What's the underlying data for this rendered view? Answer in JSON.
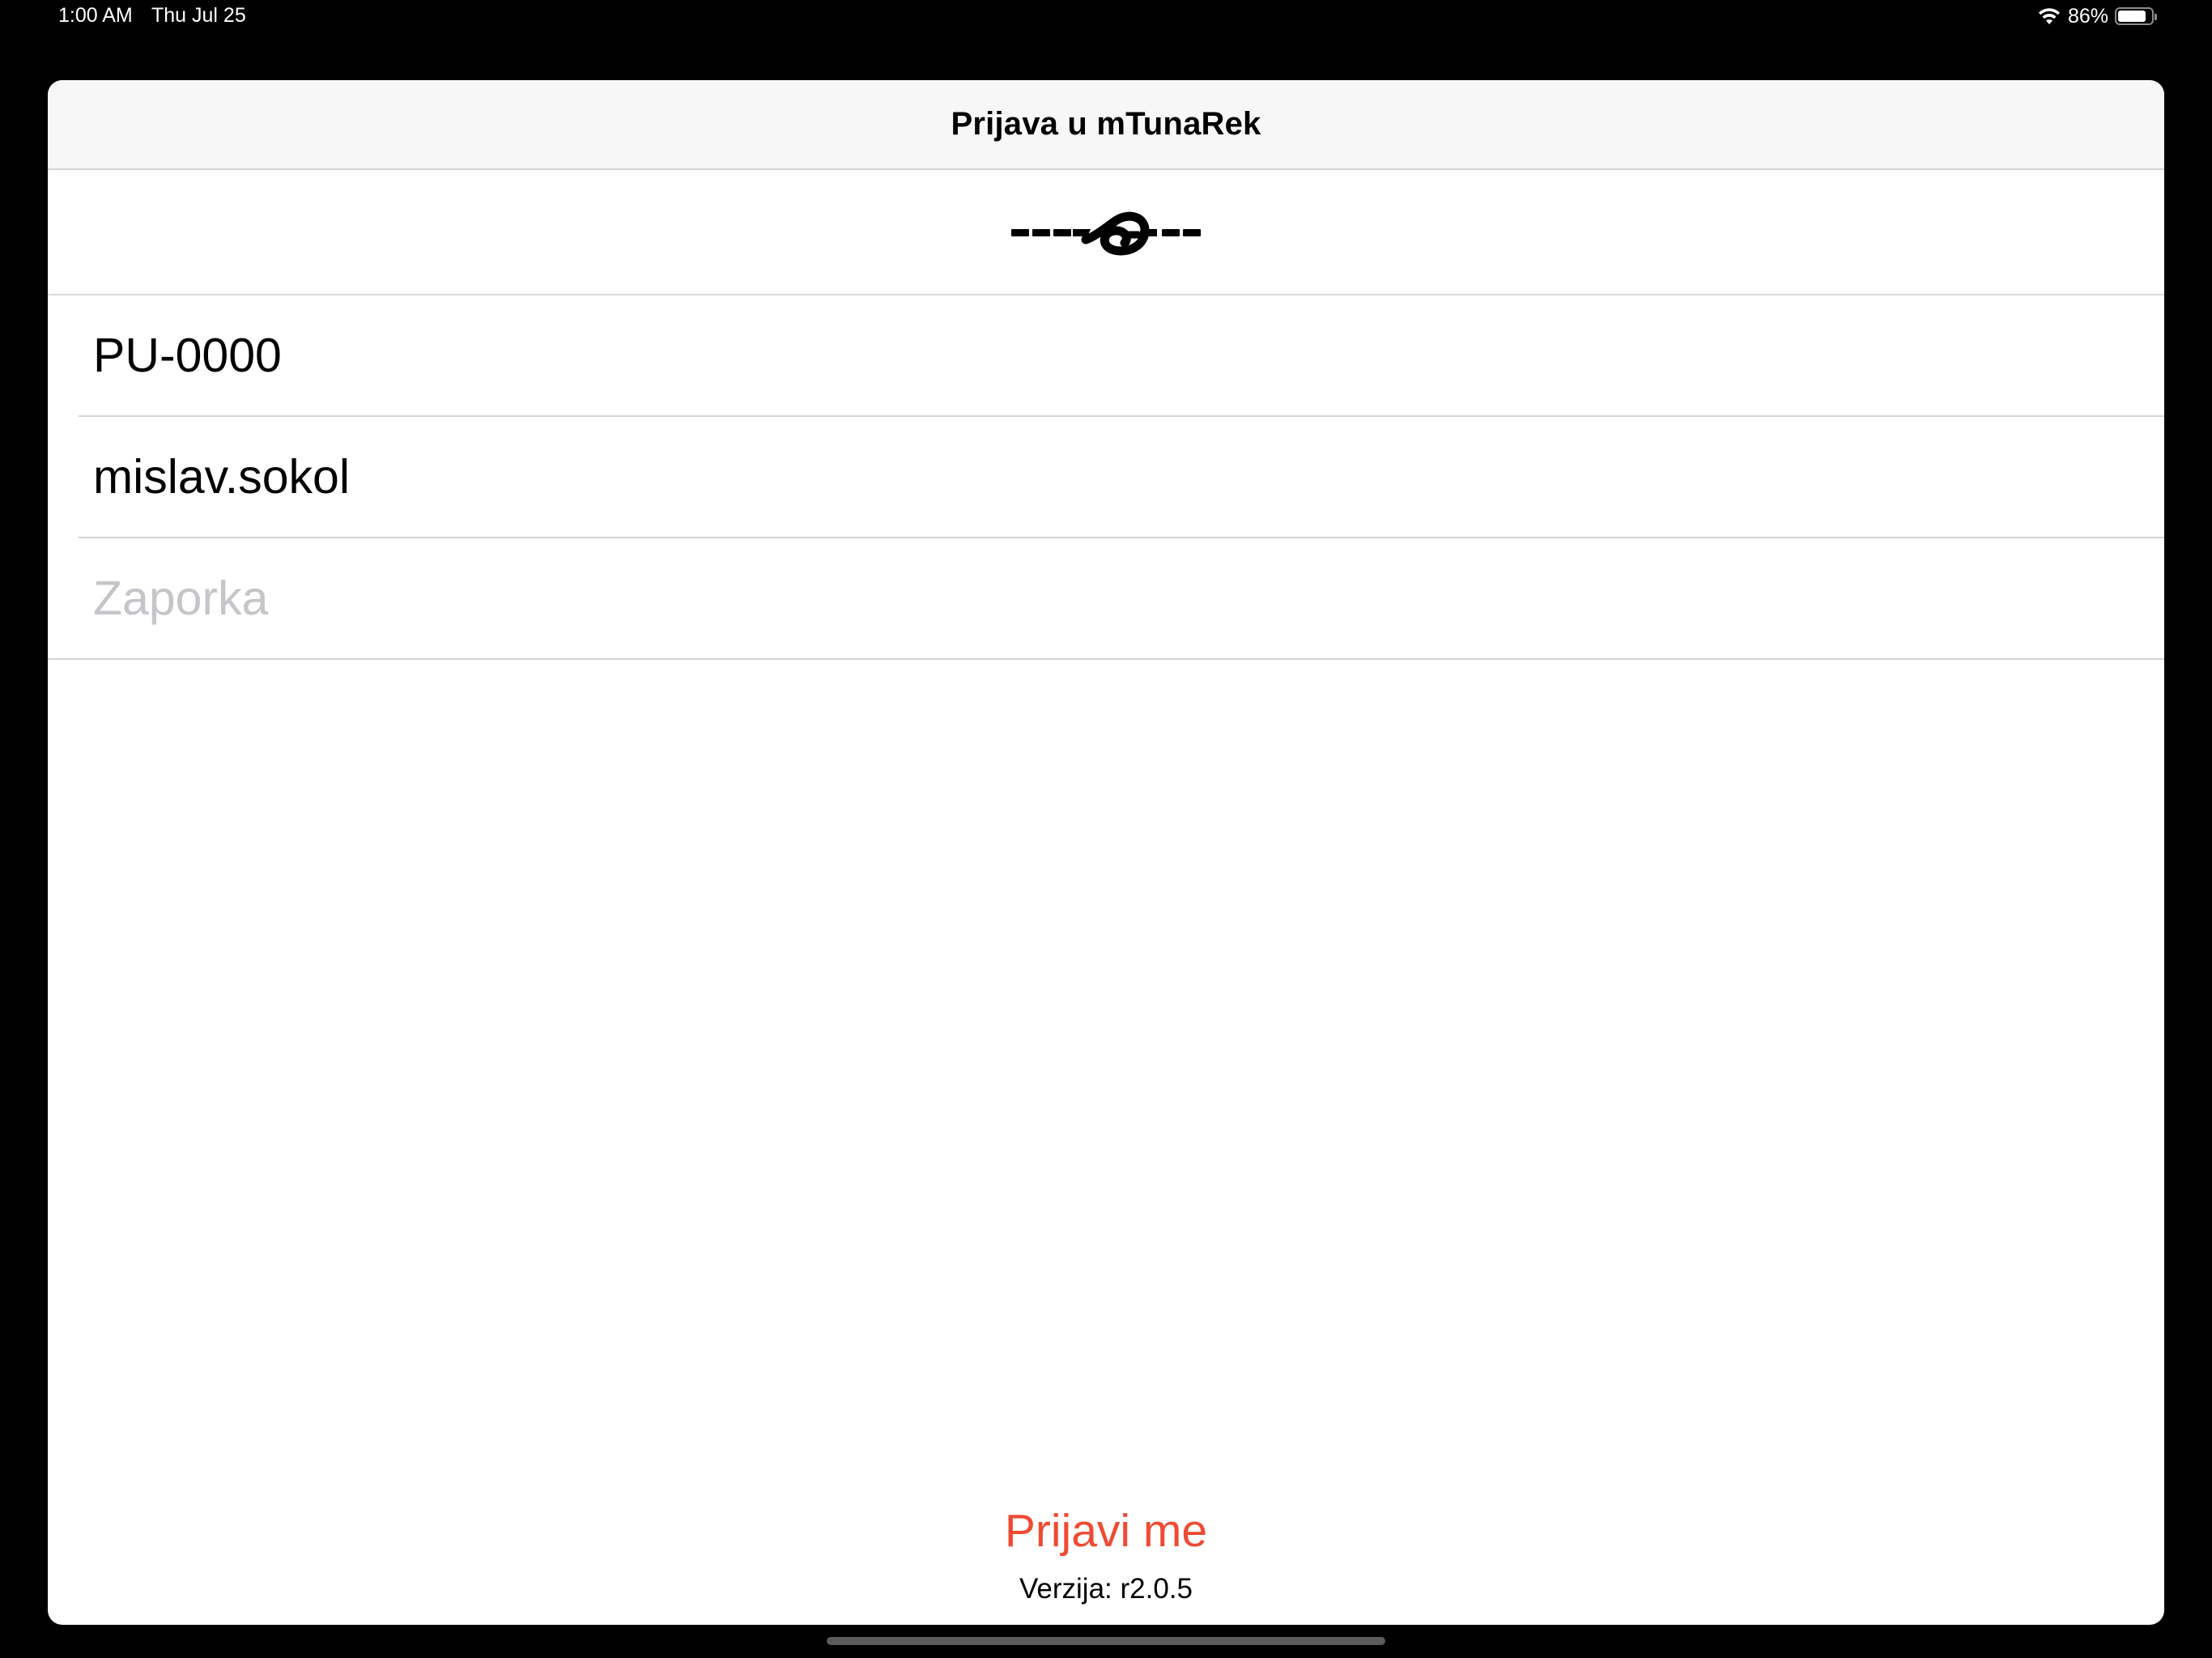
{
  "status_bar": {
    "time": "1:00 AM",
    "date": "Thu Jul 25",
    "battery_percent_label": "86%",
    "battery_level": 0.86,
    "icons": [
      "wifi-icon",
      "battery-icon"
    ]
  },
  "login_sheet": {
    "title": "Prijava u mTunaRek",
    "logo_icon": "knot-rope-logo-icon",
    "fields": {
      "station": {
        "value": "PU-0000",
        "placeholder": ""
      },
      "username": {
        "value": "mislav.sokol",
        "placeholder": ""
      },
      "password": {
        "value": "",
        "placeholder": "Zaporka"
      }
    },
    "login_button_label": "Prijavi me",
    "version_label": "Verzija: r2.0.5"
  },
  "colors": {
    "accent": "#ef4b34",
    "background": "#ffffff",
    "nav_bar": "#f7f7f7",
    "outer": "#000000",
    "separator": "#d3d3d6",
    "placeholder": "#c5c5ca"
  }
}
